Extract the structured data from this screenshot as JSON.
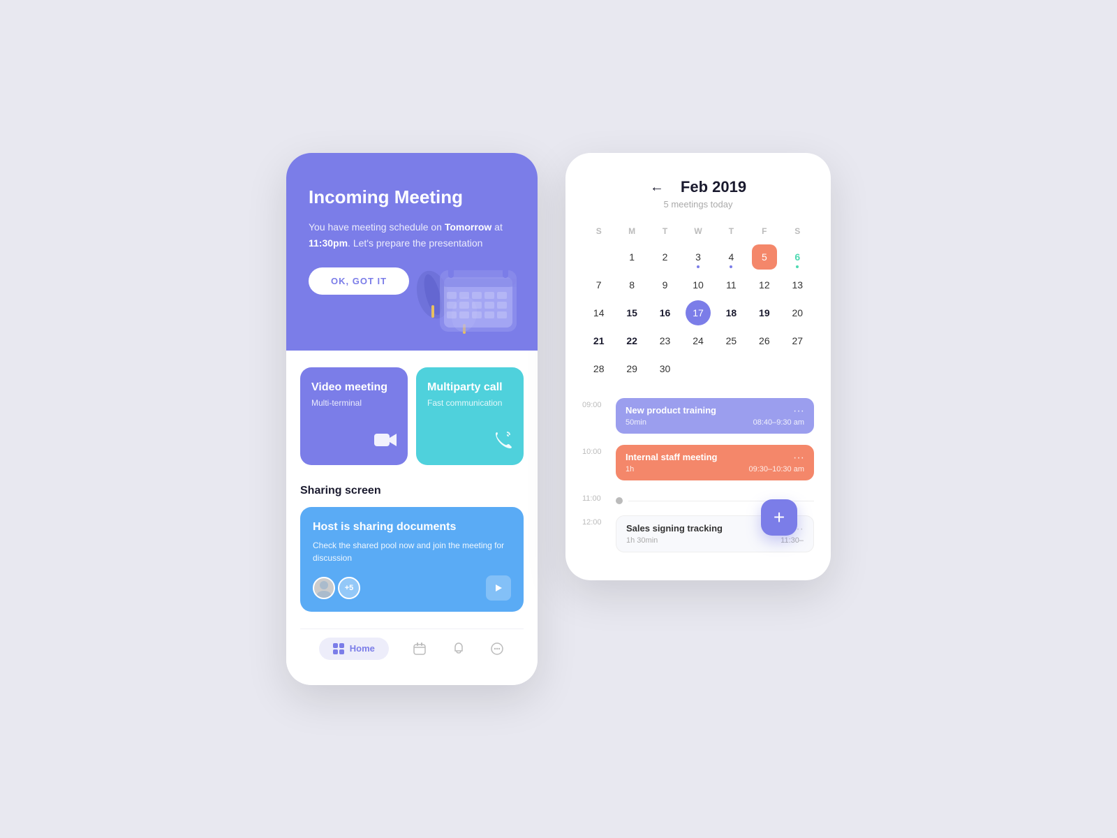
{
  "left_phone": {
    "header": {
      "title": "Incoming Meeting",
      "desc_part1": "You have meeting schedule on ",
      "desc_bold": "Tomorrow",
      "desc_part2": " at ",
      "desc_bold2": "11:30pm",
      "desc_part3": ". Let's prepare the presentation",
      "button_label": "OK, GOT IT"
    },
    "cards": [
      {
        "title": "Video meeting",
        "subtitle": "Multi-terminal",
        "icon": "🎥"
      },
      {
        "title": "Multiparty call",
        "subtitle": "Fast communication",
        "icon": "📞"
      }
    ],
    "sharing_section": {
      "section_title": "Sharing screen",
      "card_title": "Host is sharing documents",
      "card_desc": "Check the shared pool now and join the meeting for discussion",
      "avatar_count": "+5",
      "play_icon": "▶"
    },
    "nav": {
      "home_label": "Home",
      "items": [
        "calendar",
        "bell",
        "chat"
      ]
    }
  },
  "right_phone": {
    "header": {
      "month": "Feb 2019",
      "subtitle": "5 meetings today",
      "back_icon": "←"
    },
    "calendar": {
      "day_headers": [
        "S",
        "M",
        "T",
        "W",
        "T",
        "F",
        "S"
      ],
      "weeks": [
        [
          null,
          null,
          null,
          null,
          null,
          null,
          null
        ],
        [
          "1",
          "2",
          "3",
          "4",
          "5",
          "6",
          null
        ],
        [
          "7",
          "8",
          "9",
          "10",
          "11",
          "12",
          "13"
        ],
        [
          "14",
          "15",
          "16",
          "17",
          "18",
          "19",
          "20"
        ],
        [
          "21",
          "22",
          "23",
          "24",
          "25",
          "26",
          "27"
        ],
        [
          "28",
          "29",
          "30",
          null,
          null,
          null,
          null
        ]
      ]
    },
    "events": [
      {
        "time": "09:00",
        "title": "New product training",
        "duration": "50min",
        "time_range": "08:40–9:30 am",
        "color": "purple"
      },
      {
        "time": "10:00",
        "title": "Internal staff meeting",
        "duration": "1h",
        "time_range": "09:30–10:30 am",
        "color": "salmon"
      },
      {
        "time": "11:00",
        "color": "line"
      },
      {
        "time": "12:00",
        "title": "Sales signing tracking",
        "duration": "1h 30min",
        "time_range": "11:30–",
        "color": "white"
      }
    ],
    "add_button": "+"
  }
}
